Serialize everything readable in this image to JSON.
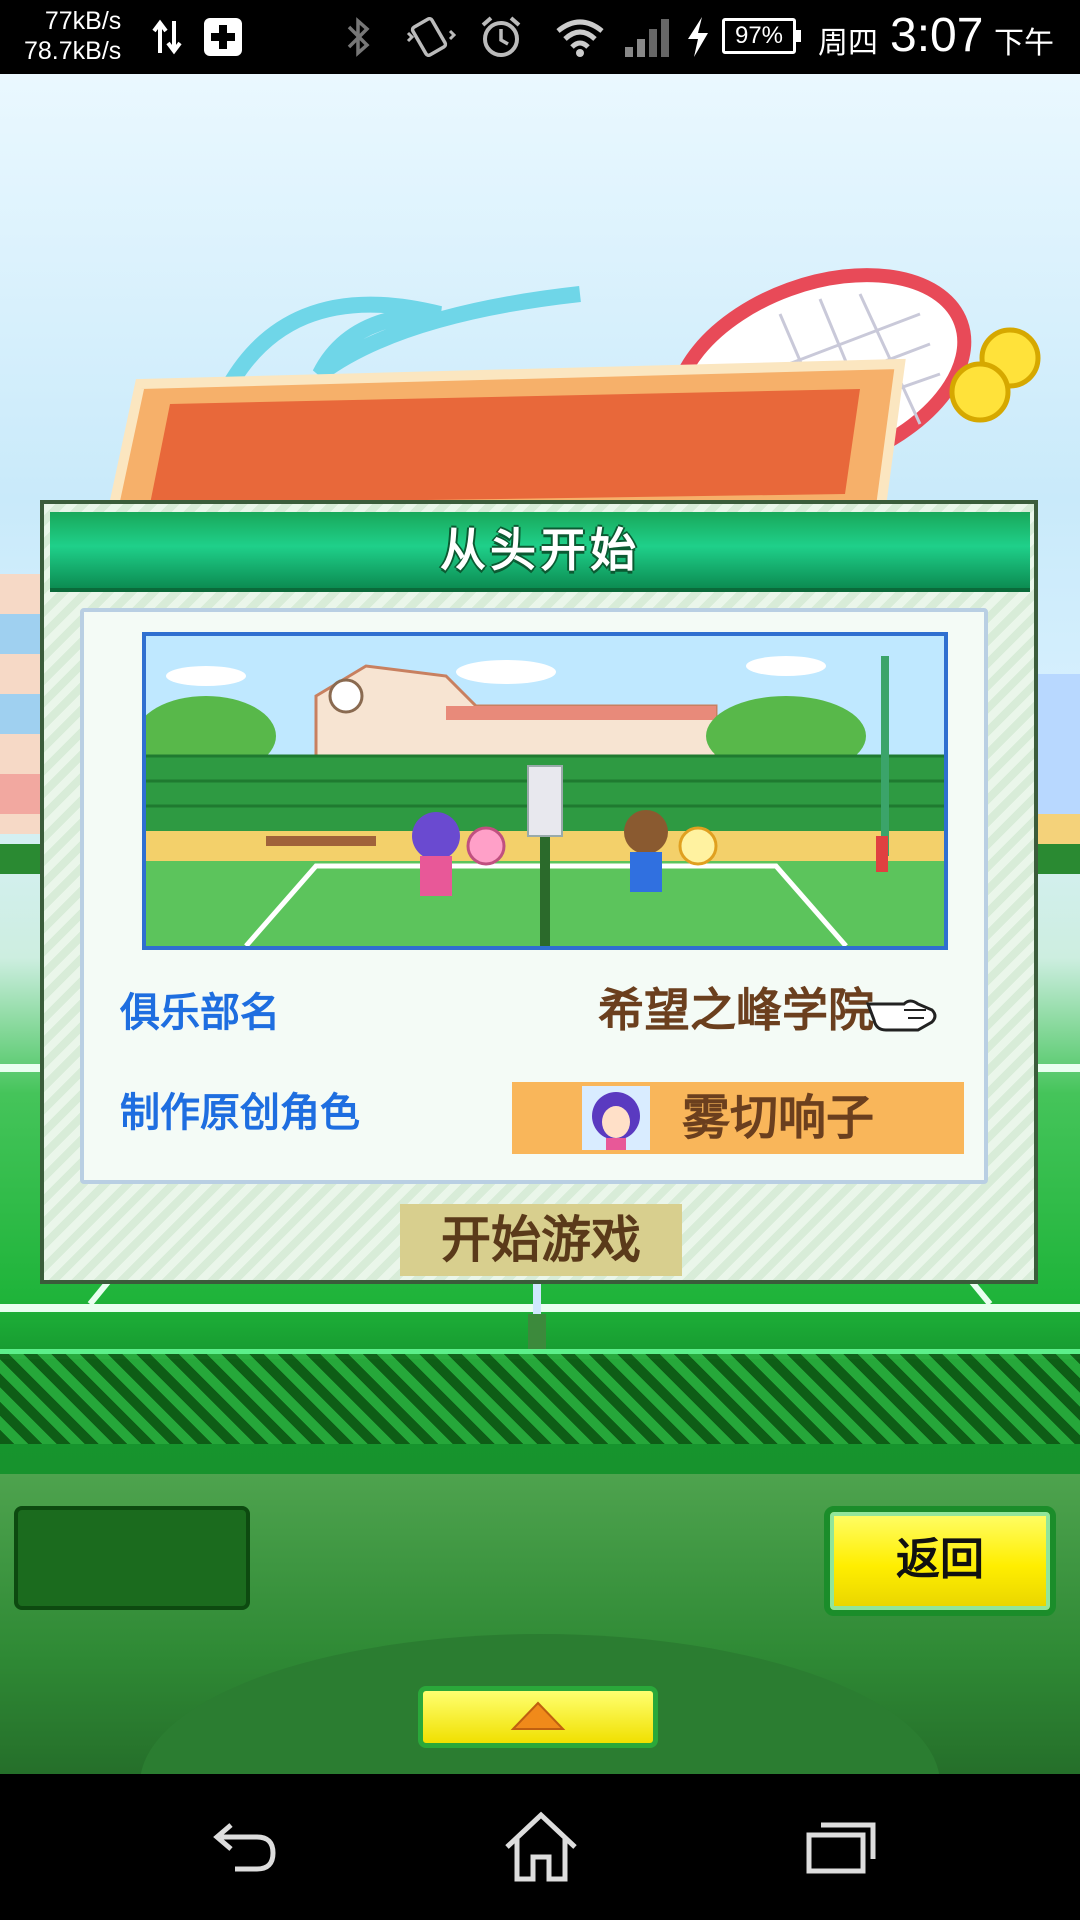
{
  "status_bar": {
    "net_down": "77kB/s",
    "net_up": "78.7kB/s",
    "battery": "97%",
    "weekday": "周四",
    "time": "3:07",
    "ampm": "下午",
    "icons": [
      "data-transfer-icon",
      "medical-plus-icon",
      "bluetooth-icon",
      "vibrate-icon",
      "alarm-icon",
      "wifi-icon",
      "signal-icon",
      "charging-icon",
      "battery-icon"
    ]
  },
  "dialog": {
    "title": "从头开始",
    "club_label": "俱乐部名",
    "club_name": "希望之峰学院",
    "character_label": "制作原创角色",
    "character_name": "雾切响子",
    "start_button": "开始游戏"
  },
  "controls": {
    "back_button": "返回"
  },
  "navbar": {
    "icons": [
      "back-icon",
      "home-icon",
      "recents-icon"
    ]
  },
  "colors": {
    "label_blue": "#1e6ee0",
    "value_brown": "#6b3f1e",
    "header_green": "#19a85a",
    "button_yellow": "#ffee00"
  }
}
